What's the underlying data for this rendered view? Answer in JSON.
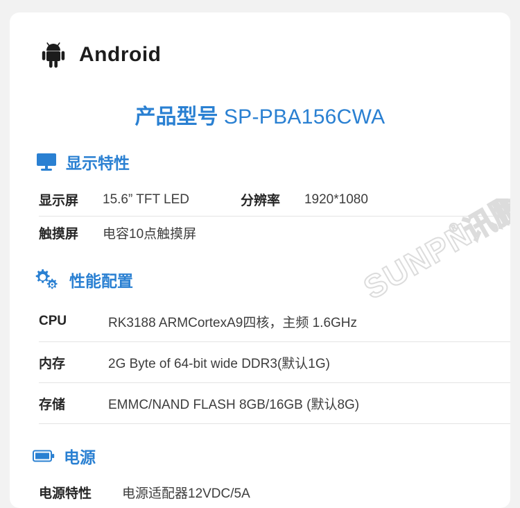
{
  "brand": {
    "icon": "android-robot-icon",
    "name": "Android"
  },
  "product": {
    "label": "产品型号",
    "model": "SP-PBA156CWA"
  },
  "watermark": {
    "text": "SUNPN",
    "registered": "®",
    "cn_text": "讯鹏"
  },
  "colors": {
    "accent": "#2a80d2",
    "text": "#2e2e2e",
    "divider": "#e3e3e3",
    "card": "#ffffff",
    "page": "#f2f2f2"
  },
  "sections": [
    {
      "id": "display",
      "icon": "monitor-icon",
      "title": "显示特性",
      "rows": [
        {
          "label": "显示屏",
          "value": "15.6”  TFT LED",
          "label2": "分辨率",
          "value2": "1920*1080"
        },
        {
          "label": "触摸屏",
          "value": "电容10点触摸屏"
        }
      ]
    },
    {
      "id": "performance",
      "icon": "gears-icon",
      "title": "性能配置",
      "rows": [
        {
          "label": "CPU",
          "value": "RK3188 ARMCortexA9四核，主频 1.6GHz"
        },
        {
          "label": "内存",
          "value": "2G Byte of 64-bit wide DDR3(默认1G)"
        },
        {
          "label": "存储",
          "value": "EMMC/NAND FLASH 8GB/16GB (默认8G)"
        }
      ]
    },
    {
      "id": "power",
      "icon": "battery-icon",
      "title": "电源",
      "rows": [
        {
          "label": "电源特性",
          "value": "电源适配器12VDC/5A"
        }
      ]
    }
  ]
}
